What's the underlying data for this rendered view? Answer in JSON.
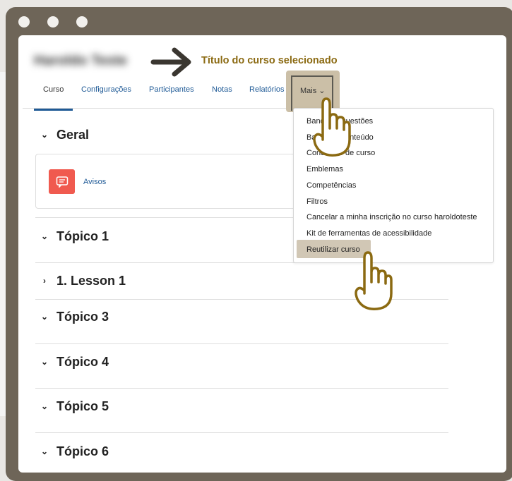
{
  "window": {
    "dots": [
      "close",
      "minimize",
      "maximize"
    ]
  },
  "course": {
    "title": "Haroldo Teste"
  },
  "annotation": {
    "text": "Título do curso selecionado",
    "color": "#8b6a12"
  },
  "nav": {
    "tabs": [
      "Curso",
      "Configurações",
      "Participantes",
      "Notas",
      "Relatórios"
    ],
    "active_tab": "Curso",
    "more_label": "Mais ⌄"
  },
  "sections": [
    {
      "title": "Geral",
      "expanded": true
    },
    {
      "title": "Tópico 1",
      "expanded": true
    },
    {
      "title": "1. Lesson 1",
      "expanded": false
    },
    {
      "title": "Tópico 3",
      "expanded": true
    },
    {
      "title": "Tópico 4",
      "expanded": true
    },
    {
      "title": "Tópico 5",
      "expanded": true
    },
    {
      "title": "Tópico 6",
      "expanded": true
    }
  ],
  "activity": {
    "label": "Avisos",
    "icon": "forum-icon",
    "color": "#f05a4f"
  },
  "dropdown": {
    "items": [
      "Banco de questões",
      "Banco de conteúdo",
      "Conclusão de curso",
      "Emblemas",
      "Competências",
      "Filtros",
      "Cancelar a minha inscrição no curso haroldoteste",
      "Kit de ferramentas de acessibilidade",
      "Reutilizar curso"
    ],
    "highlighted": "Reutilizar curso"
  },
  "colors": {
    "accent": "#1f5a96",
    "frame": "#6e6558",
    "highlight": "#cbbfa7",
    "pointer": "#8b6a12"
  }
}
